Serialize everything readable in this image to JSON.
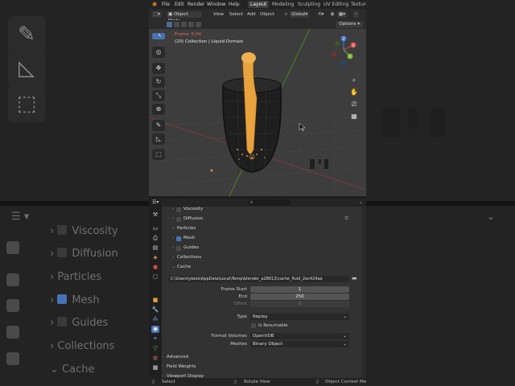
{
  "app": {
    "menu": [
      "File",
      "Edit",
      "Render",
      "Window",
      "Help"
    ],
    "workspaces": [
      "Layout",
      "Modeling",
      "Sculpting",
      "UV Editing",
      "Texture"
    ]
  },
  "header": {
    "mode": "Object Mode",
    "menus": [
      "View",
      "Select",
      "Add",
      "Object"
    ],
    "transform_orientation": "Global",
    "options": "Options"
  },
  "viewport": {
    "overlay_line1": "Frame: 0.04",
    "overlay_line2": "(20) Collection | Liquid Domain",
    "gizmo": {
      "x": "X",
      "y": "Y",
      "z": "Z"
    }
  },
  "properties": {
    "rows": {
      "viscosity": "Viscosity",
      "diffusion": "Diffusion",
      "particles": "Particles",
      "mesh": "Mesh",
      "guides": "Guides",
      "collections": "Collections",
      "cache": "Cache",
      "advanced": "Advanced",
      "field_weights": "Field Weights",
      "viewport_display": "Viewport Display"
    },
    "cache": {
      "path": "C:\\Users\\ybela\\AppData\\Local\\Temp\\blender_a28612\\cache_fluid_2ec424aa",
      "frame_start_label": "Frame Start",
      "frame_start": "1",
      "end_label": "End",
      "end": "250",
      "offset_label": "Offset",
      "offset": "0",
      "type_label": "Type",
      "type": "Replay",
      "resumable": "Is Resumable",
      "format_volumes_label": "Format Volumes",
      "format_volumes": "OpenVDB",
      "meshes_label": "Meshes",
      "meshes": "Binary Object"
    }
  },
  "statusbar": {
    "select": "Select",
    "rotate": "Rotate View",
    "context": "Object Context Menu"
  },
  "background": {
    "viscosity": "Viscosity",
    "diffusion": "Diffusion",
    "particles": "Particles",
    "mesh": "Mesh",
    "guides": "Guides",
    "collections": "Collections",
    "cache": "Cache"
  }
}
